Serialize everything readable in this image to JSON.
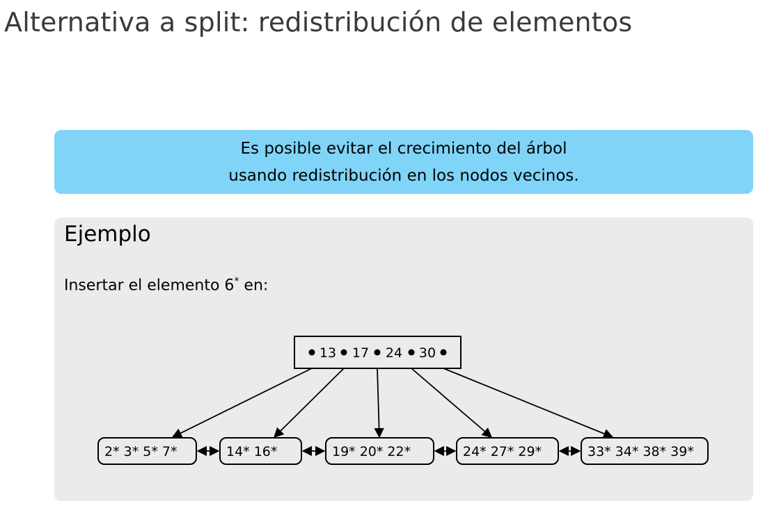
{
  "title": "Alternativa a split: redistribución de elementos",
  "note": {
    "line1": "Es posible evitar el crecimiento del árbol",
    "line2": "usando redistribución en los nodos vecinos."
  },
  "example": {
    "title": "Ejemplo",
    "text_prefix": "Insertar el elemento 6",
    "text_sup": "*",
    "text_suffix": " en:"
  },
  "tree": {
    "root_keys": [
      "13",
      "17",
      "24",
      "30"
    ],
    "leaves": [
      [
        "2*",
        "3*",
        "5*",
        "7*"
      ],
      [
        "14*",
        "16*"
      ],
      [
        "19*",
        "20*",
        "22*"
      ],
      [
        "24*",
        "27*",
        "29*"
      ],
      [
        "33*",
        "34*",
        "38*",
        "39*"
      ]
    ]
  },
  "colors": {
    "note_bg": "#80d4f7",
    "block_bg": "#ebebeb",
    "title": "#3a3a3a"
  }
}
